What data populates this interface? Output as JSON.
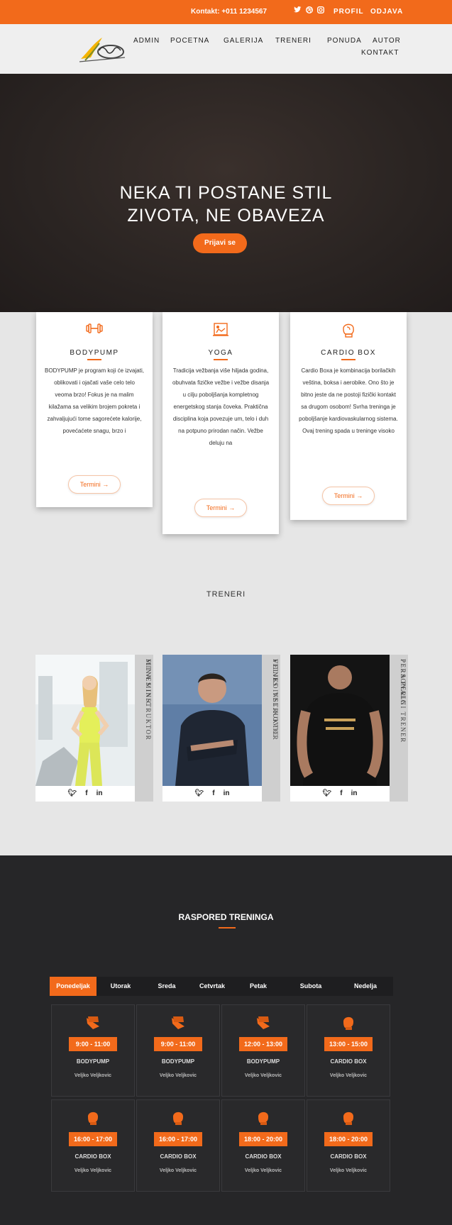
{
  "topbar": {
    "contact": "Kontakt: +011 1234567",
    "social_icons": [
      "twitter-icon",
      "dribbble-icon",
      "instagram-icon"
    ],
    "profile": "PROFIL",
    "logout": "ODJAVA"
  },
  "nav": {
    "items": [
      "ADMIN",
      "POCETNA",
      "GALERIJA",
      "TRENERI",
      "PONUDA",
      "AUTOR",
      "KONTAKT"
    ]
  },
  "hero": {
    "title_line1": "NEKA TI POSTANE STIL",
    "title_line2": "ZIVOTA, NE OBAVEZA",
    "button": "Prijavi se"
  },
  "programs": [
    {
      "title": "BODYPUMP",
      "icon": "dumbbell-icon",
      "text": "BODYPUMP je program koji će izvajati, oblikovati i ojačati vaše celo telo veoma brzo! Fokus je na malim kilažama sa velikim brojem pokreta i zahvaljujući tome sagorećete kalorije, povećaćete snagu, brzo i",
      "button": "Termini →"
    },
    {
      "title": "YOGA",
      "icon": "yoga-icon",
      "text": "Tradicija vežbanja više hiljada godina, obuhvata fizičke vežbe i vežbe disanja u cilju poboljšanja kompletnog energetskog stanja čoveka. Praktična disciplina koja povezuje um, telo i duh na potpuno prirodan način. Vežbe deluju na",
      "button": "Termini →"
    },
    {
      "title": "CARDIO BOX",
      "icon": "boxing-glove-icon",
      "text": "Cardio Boxa je kombinacija borilačkih veština, boksa i aerobike. Ono što je bitno jeste da ne postoji fizički kontakt sa drugom osobom! Svrha treninga je poboljšanje kardiovaskularnog sistema. Ovaj trening spada u treninge visoko",
      "button": "Termini →"
    }
  ],
  "trainers_title": "TRENERI",
  "trainers": [
    {
      "name": "MINA MINIC",
      "role": "FITNES INSTRUKTOR"
    },
    {
      "name": "VELJKO VELJKOVIC",
      "role": "FITNES INSTRUKTOR"
    },
    {
      "name": "PERA PERIC",
      "role": "PERSONALNI TRENER"
    }
  ],
  "schedule": {
    "title": "RASPORED TRENINGA",
    "days": [
      "Ponedeljak",
      "Utorak",
      "Sreda",
      "Cetvrtak",
      "Petak",
      "Subota",
      "Nedelja"
    ],
    "active_day": "Ponedeljak",
    "sessions": [
      {
        "time": "9:00 - 11:00",
        "class": "BODYPUMP",
        "trainer": "Veljko Veljkovic"
      },
      {
        "time": "9:00 - 11:00",
        "class": "BODYPUMP",
        "trainer": "Veljko Veljkovic"
      },
      {
        "time": "12:00 - 13:00",
        "class": "BODYPUMP",
        "trainer": "Veljko Veljkovic"
      },
      {
        "time": "13:00 - 15:00",
        "class": "CARDIO BOX",
        "trainer": "Veljko Veljkovic"
      },
      {
        "time": "16:00 - 17:00",
        "class": "CARDIO BOX",
        "trainer": "Veljko Veljkovic"
      },
      {
        "time": "16:00 - 17:00",
        "class": "CARDIO BOX",
        "trainer": "Veljko Veljkovic"
      },
      {
        "time": "18:00 - 20:00",
        "class": "CARDIO BOX",
        "trainer": "Veljko Veljkovic"
      },
      {
        "time": "18:00 - 20:00",
        "class": "CARDIO BOX",
        "trainer": "Veljko Veljkovic"
      }
    ]
  },
  "colors": {
    "accent": "#f26a1b",
    "dark": "#262628",
    "light": "#e6e6e6"
  }
}
